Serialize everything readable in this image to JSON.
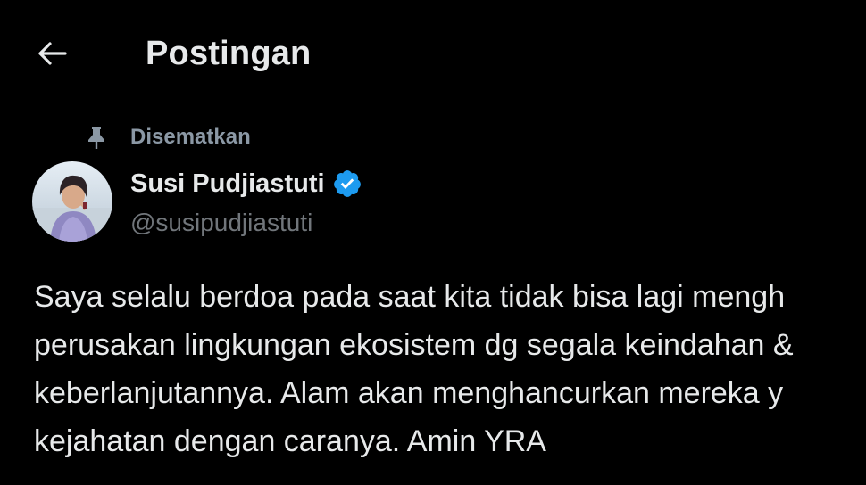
{
  "header": {
    "back_icon": "arrow-left-icon",
    "title": "Postingan"
  },
  "pinned": {
    "icon": "pin-icon",
    "label": "Disematkan"
  },
  "author": {
    "display_name": "Susi Pudjiastuti",
    "handle": "@susipudjiastuti",
    "verified_icon": "verified-badge-icon",
    "verified_color": "#1d9bf0"
  },
  "post": {
    "lines": [
      "Saya selalu berdoa pada saat kita tidak bisa lagi mengh",
      "perusakan lingkungan ekosistem dg segala keindahan &",
      "keberlanjutannya. Alam akan menghancurkan mereka y",
      "kejahatan dengan caranya. Amin YRA"
    ]
  },
  "colors": {
    "background": "#000000",
    "primary_text": "#e7e9ea",
    "secondary_text": "#71767b",
    "pinned_text": "#8b98a5",
    "accent": "#1d9bf0"
  }
}
